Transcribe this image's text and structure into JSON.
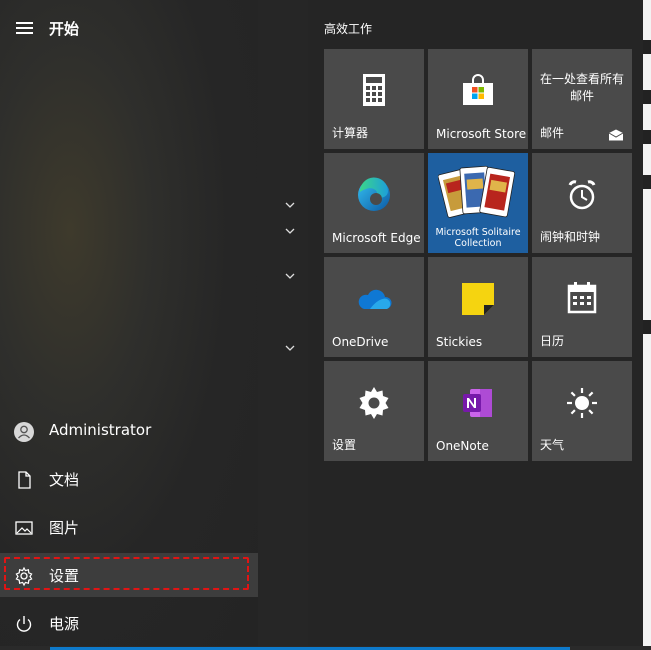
{
  "start_menu": {
    "title": "开始"
  },
  "rail": {
    "user": "Administrator",
    "documents": "文档",
    "pictures": "图片",
    "settings": "设置",
    "power": "电源"
  },
  "tiles": {
    "group_title": "高效工作",
    "calculator": "计算器",
    "store": "Microsoft Store",
    "mail_top": "在一处查看所有邮件",
    "mail": "邮件",
    "edge": "Microsoft Edge",
    "solitaire": "Microsoft Solitaire Collection",
    "alarms": "闹钟和时钟",
    "onedrive": "OneDrive",
    "stickies": "Stickies",
    "calendar": "日历",
    "settings": "设置",
    "onenote": "OneNote",
    "weather": "天气"
  }
}
